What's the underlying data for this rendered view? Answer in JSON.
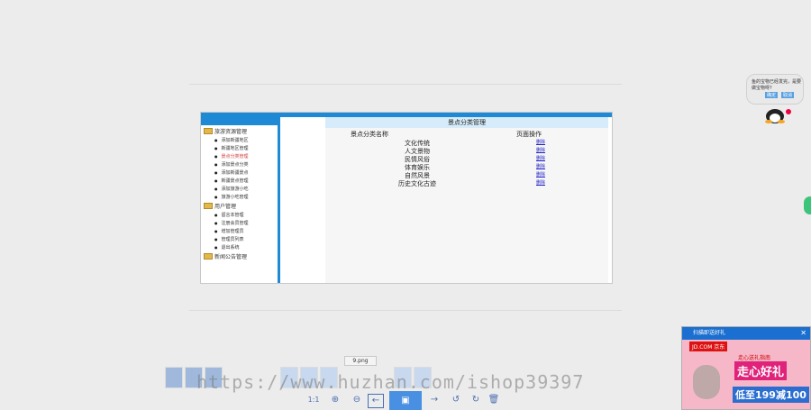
{
  "app": {
    "sidebar": {
      "groups": [
        {
          "label": "旅游资源管理",
          "items": [
            "添加新疆地区",
            "新疆地区管理",
            "景点分类管理",
            "添加景点分类",
            "添加新疆景点",
            "新疆景点管理",
            "添加旅游小吃",
            "旅游小吃管理"
          ],
          "active_index": 2
        },
        {
          "label": "用户管理",
          "items": [
            "留言本管理",
            "注册会员管理",
            "增加管理员",
            "管理员列表",
            "退出系统"
          ]
        },
        {
          "label": "新闻公告管理",
          "items": []
        }
      ]
    },
    "panel": {
      "title": "景点分类管理",
      "col_name": "景点分类名称",
      "col_ops": "页面操作",
      "rows": [
        {
          "name": "文化传统",
          "op": "删除"
        },
        {
          "name": "人文景物",
          "op": "删除"
        },
        {
          "name": "民情风俗",
          "op": "删除"
        },
        {
          "name": "体育娱乐",
          "op": "删除"
        },
        {
          "name": "自然风景",
          "op": "删除"
        },
        {
          "name": "历史文化古迹",
          "op": "删除"
        }
      ]
    }
  },
  "bubble": {
    "text": "鱼的宝物已经发完，是要做宝物呀?",
    "btn1": "确定",
    "btn2": "取消"
  },
  "ad": {
    "top": "扫描即送好礼",
    "jd": "JD.COM 京东",
    "mid": "走心送礼指南",
    "main": "走心好礼",
    "sub": "低至199减100"
  },
  "viewer": {
    "label": "9.png",
    "zoom_label": "1:1"
  },
  "watermark": "https://www.huzhan.com/ishop39397",
  "colors": {
    "accent": "#1e8ad6",
    "header_bg": "#d7ecfa",
    "link": "#2020c8"
  }
}
